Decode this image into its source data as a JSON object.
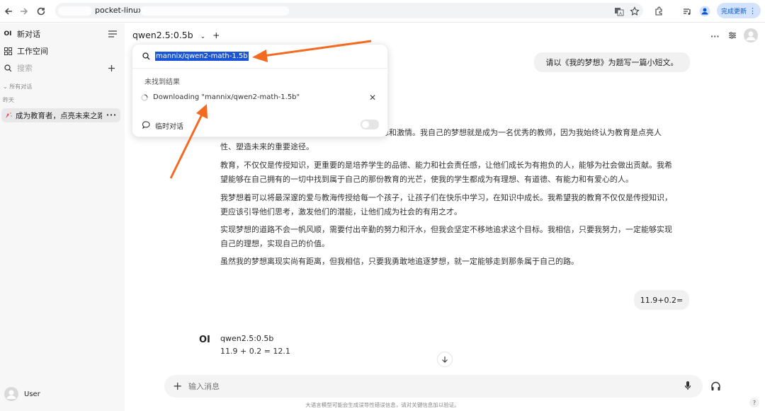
{
  "browser": {
    "url": "pocket-linux/",
    "update_label": "完成更新",
    "icons": [
      "back-icon",
      "forward-icon",
      "reload-icon",
      "translate-icon",
      "star-icon",
      "extensions-icon",
      "media-icon",
      "profile-icon",
      "more-icon"
    ]
  },
  "sidebar": {
    "new_chat": "新对话",
    "workspace": "工作空间",
    "search_placeholder": "搜索",
    "all_chats": "所有对话",
    "yesterday": "昨天",
    "chat_title": "成为教育者，点亮未来之路",
    "user_name": "User"
  },
  "header": {
    "model_name": "qwen2.5:0.5b"
  },
  "model_dropdown": {
    "search_value": "mannix/qwen2-math-1.5b",
    "no_results": "未找到结果",
    "downloading": "Downloading \"mannix/qwen2-math-1.5b\"",
    "temp_chat": "临时对话"
  },
  "conversation": {
    "user_msg_1": "请以《我的梦想》为题写一篇小短文。",
    "paragraphs": [
      "想和激情。我自己的梦想就是成为一名优秀的教师，因为我始终认为教育是点亮人",
      "性、塑造未来的重要途径。",
      "教育，不仅仅是传授知识，更重要的是培养学生的品德、能力和社会责任感，让他们成长为有抱负的人，能够为社会做出贡献。我希",
      "望能够在自己拥有的一切中找到属于自己的那份教育的光芒，使我的学生都成为有理想、有道德、有能力和有爱心的人。",
      "我梦想着可以将最深邃的爱与教海传授给每一个孩子，让孩子们在快乐中学习，在知识中成长。我希望我的教育不仅仅是传授知识，",
      "更应该引导他们思考，激发他们的潜能，让他们成为社会的有用之才。",
      "实现梦想的道路不会一帆风顺，需要付出辛勤的努力和汗水，但我会坚定不移地追求这个目标。我相信，只要我努力，一定能够实现",
      "自己的理想，实现自己的价值。",
      "虽然我的梦想离现实尚有距离，但我相信，只要我勇敢地追逐梦想，就一定能够走到那条属于自己的路。"
    ],
    "user_msg_2": "11.9+0.2=",
    "assistant_name": "qwen2.5:0.5b",
    "assistant_reply": "11.9 + 0.2 = 12.1",
    "assistant_logo": "OI"
  },
  "composer": {
    "placeholder": "输入消息",
    "disclaimer": "大语言模型可能会生成误导性错误信息，请对关键信息加以验证。",
    "help": "?"
  },
  "colors": {
    "accent": "#1a55d6",
    "arrow": "#f26b21",
    "sidebar_bg": "#f7f7f7",
    "bubble_bg": "#f1f1f1"
  }
}
